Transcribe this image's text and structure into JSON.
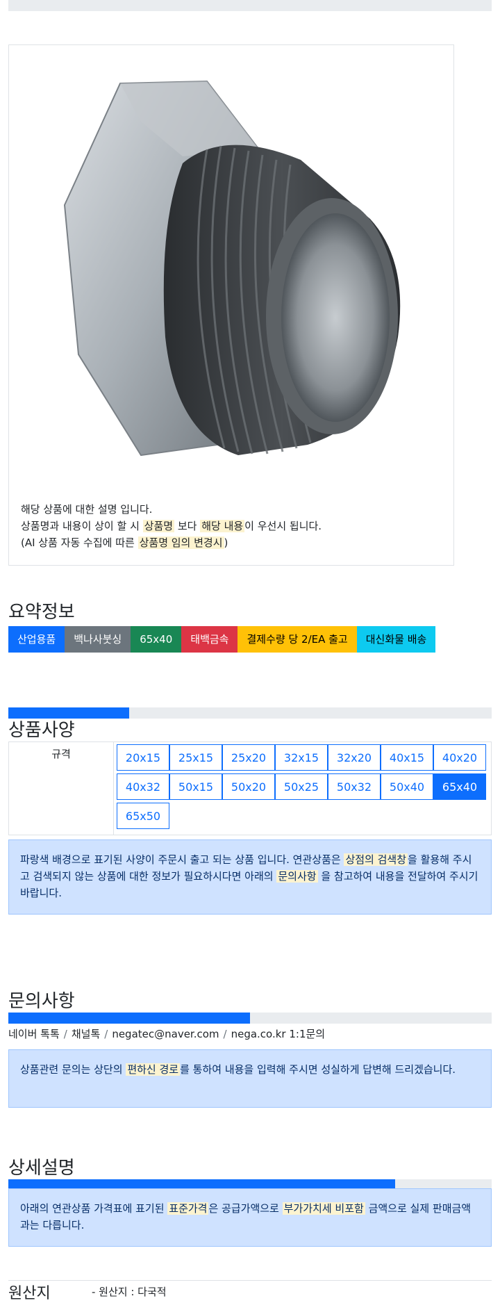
{
  "product_description": {
    "line1": "해당 상품에 대한 설명 입니다.",
    "line2_a": "상품명과 내용이 상이 할 시 ",
    "line2_mark1": "상품명",
    "line2_b": " 보다 ",
    "line2_mark2": "해당 내용",
    "line2_c": "이 우선시 됩니다.",
    "line3_a": "(AI 상품 자동 수집에 따른 ",
    "line3_mark": "상품명 임의 변경시",
    "line3_b": ")"
  },
  "summary": {
    "title": "요약정보",
    "badges": [
      {
        "label": "산업용품",
        "color": "#0d6efd",
        "text_color": "#ffffff"
      },
      {
        "label": "백나사붓싱",
        "color": "#6c757d",
        "text_color": "#ffffff"
      },
      {
        "label": "65x40",
        "color": "#198754",
        "text_color": "#ffffff"
      },
      {
        "label": "태백금속",
        "color": "#dc3545",
        "text_color": "#ffffff"
      },
      {
        "label": "결제수량 당 2/EA 출고",
        "color": "#ffc107",
        "text_color": "#000000"
      },
      {
        "label": "대신화물 배송",
        "color": "#0dcaf0",
        "text_color": "#000000"
      }
    ]
  },
  "spec": {
    "title": "상품사양",
    "progress": 0.25,
    "label": "규격",
    "options": [
      "20x15",
      "25x15",
      "25x20",
      "32x15",
      "32x20",
      "40x15",
      "40x20",
      "40x32",
      "50x15",
      "50x20",
      "50x25",
      "50x32",
      "50x40",
      "65x40",
      "65x50"
    ],
    "selected": "65x40",
    "notice_a": "파랑색 배경으로 표기된 사양이 주문시 출고 되는 상품 입니다. 연관상품은 ",
    "notice_mark1": "상점의 검색창",
    "notice_b": "을 활용해 주시고 검색되지 않는 상품에 대한 정보가 필요하시다면 아래의 ",
    "notice_mark2": "문의사항",
    "notice_c": " 을 참고하여 내용을 전달하여 주시기 바랍니다."
  },
  "inquiry": {
    "title": "문의사항",
    "progress": 0.5,
    "channels": [
      "네이버 톡톡",
      "채널톡",
      "negatec@naver.com",
      "nega.co.kr 1:1문의"
    ],
    "notice_a": "상품관련 문의는 상단의 ",
    "notice_mark": "편하신 경로",
    "notice_b": "를 통하여 내용을 입력해 주시면 성실하게 답변해 드리겠습니다."
  },
  "detail": {
    "title": "상세설명",
    "progress": 0.8,
    "notice_a": "아래의 연관상품 가격표에 표기된 ",
    "notice_mark1": "표준가격",
    "notice_b": "은 공급가액으로 ",
    "notice_mark2": "부가가치세 비포함",
    "notice_c": " 금액으로 실제 판매금액과는 다릅니다."
  },
  "origin": {
    "label": "원산지",
    "value": "- 원산지 : 다국적"
  }
}
